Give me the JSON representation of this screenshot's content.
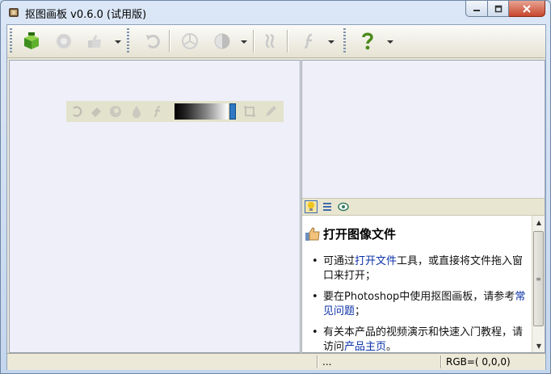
{
  "window": {
    "title": "抠图画板 v0.6.0 (试用版)"
  },
  "toolbar": {
    "buttons": [
      {
        "name": "open-image",
        "icon": "green-cube-icon"
      },
      {
        "name": "save-image",
        "icon": "gear-disc-icon"
      },
      {
        "name": "thumbs-up",
        "icon": "thumbs-up-icon"
      },
      {
        "name": "undo",
        "icon": "undo-arrow-icon"
      },
      {
        "name": "aperture",
        "icon": "aperture-icon"
      },
      {
        "name": "contrast",
        "icon": "half-circle-icon"
      },
      {
        "name": "curves",
        "icon": "wave-icon"
      },
      {
        "name": "function",
        "icon": "function-f-icon"
      },
      {
        "name": "help",
        "icon": "question-mark-icon"
      }
    ]
  },
  "help": {
    "title": "打开图像文件",
    "items": [
      {
        "pre": "可通过",
        "link": "打开文件",
        "post": "工具，或直接将文件拖入窗口来打开；"
      },
      {
        "pre": "要在Photoshop中使用抠图画板，请参考",
        "link": "常见问题",
        "post": "；"
      },
      {
        "pre": "有关本产品的视频演示和快速入门教程，请访问",
        "link": "产品主页",
        "post": "。"
      }
    ]
  },
  "status": {
    "left": "",
    "middle": "...",
    "rgb": "RGB=( 0,0,0)"
  },
  "colors": {
    "accent": "#2f78c4",
    "link": "#0b31a8",
    "help_green": "#4d8a1c"
  }
}
